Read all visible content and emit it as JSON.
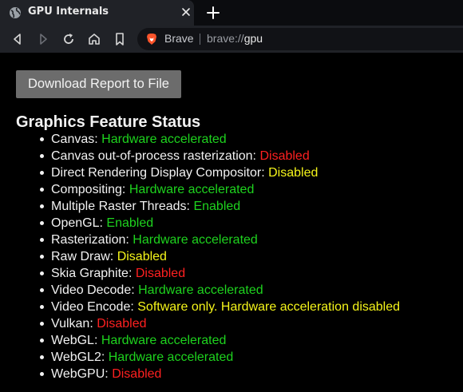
{
  "browser": {
    "tab": {
      "title": "GPU Internals"
    },
    "address": {
      "brand": "Brave",
      "url_prefix": "brave://",
      "url_host": "gpu"
    }
  },
  "page": {
    "download_button": "Download Report to File",
    "section_title": "Graphics Feature Status",
    "features": [
      {
        "name": "Canvas:",
        "status": "Hardware accelerated",
        "tone": "green"
      },
      {
        "name": "Canvas out-of-process rasterization:",
        "status": "Disabled",
        "tone": "red"
      },
      {
        "name": "Direct Rendering Display Compositor:",
        "status": "Disabled",
        "tone": "yellow"
      },
      {
        "name": "Compositing:",
        "status": "Hardware accelerated",
        "tone": "green"
      },
      {
        "name": "Multiple Raster Threads:",
        "status": "Enabled",
        "tone": "green"
      },
      {
        "name": "OpenGL:",
        "status": "Enabled",
        "tone": "green"
      },
      {
        "name": "Rasterization:",
        "status": "Hardware accelerated",
        "tone": "green"
      },
      {
        "name": "Raw Draw:",
        "status": "Disabled",
        "tone": "yellow"
      },
      {
        "name": "Skia Graphite:",
        "status": "Disabled",
        "tone": "red"
      },
      {
        "name": "Video Decode:",
        "status": "Hardware accelerated",
        "tone": "green"
      },
      {
        "name": "Video Encode:",
        "status": "Software only. Hardware acceleration disabled",
        "tone": "yellow"
      },
      {
        "name": "Vulkan:",
        "status": "Disabled",
        "tone": "red"
      },
      {
        "name": "WebGL:",
        "status": "Hardware accelerated",
        "tone": "green"
      },
      {
        "name": "WebGL2:",
        "status": "Hardware accelerated",
        "tone": "green"
      },
      {
        "name": "WebGPU:",
        "status": "Disabled",
        "tone": "red"
      }
    ],
    "colors": {
      "green": "#1ed31e",
      "red": "#ff2020",
      "yellow": "#f5f51a",
      "background": "#000000"
    }
  }
}
